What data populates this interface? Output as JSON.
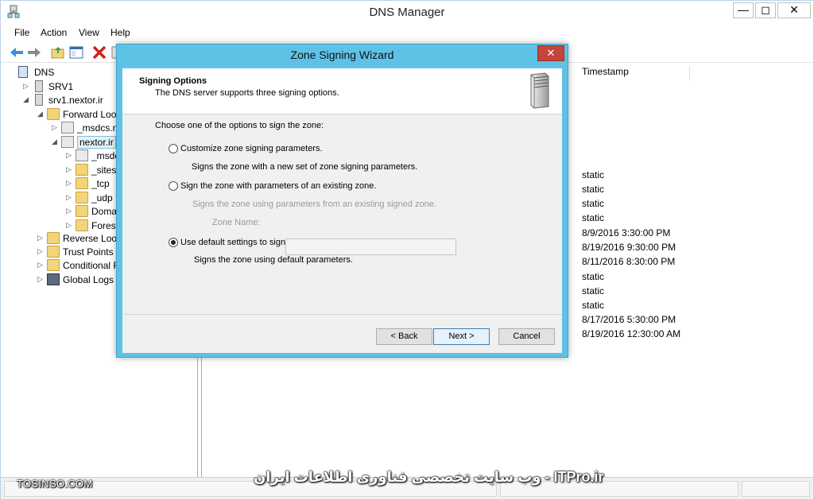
{
  "app": {
    "title": "DNS Manager"
  },
  "window_controls": {
    "minimize": "—",
    "maximize": "◻",
    "close": "✕"
  },
  "menu": [
    "File",
    "Action",
    "View",
    "Help"
  ],
  "tree": [
    {
      "label": "DNS",
      "arrow": ""
    },
    {
      "label": "SRV1",
      "arrow": "▷"
    },
    {
      "label": "srv1.nextor.ir",
      "arrow": "◢"
    },
    {
      "label": "Forward Looku",
      "arrow": "◢"
    },
    {
      "label": "_msdcs.nex",
      "arrow": "▷"
    },
    {
      "label": "nextor.ir",
      "arrow": "◢"
    },
    {
      "label": "_msdcs",
      "arrow": "▷"
    },
    {
      "label": "_sites",
      "arrow": "▷"
    },
    {
      "label": "_tcp",
      "arrow": "▷"
    },
    {
      "label": "_udp",
      "arrow": "▷"
    },
    {
      "label": "Domain",
      "arrow": "▷"
    },
    {
      "label": "ForestDu",
      "arrow": "▷"
    },
    {
      "label": "Reverse Lookup",
      "arrow": "▷"
    },
    {
      "label": "Trust Points",
      "arrow": "▷"
    },
    {
      "label": "Conditional For",
      "arrow": "▷"
    },
    {
      "label": "Global Logs",
      "arrow": "▷"
    }
  ],
  "list": {
    "column_timestamp": "Timestamp",
    "timestamps": [
      "static",
      "static",
      "static",
      "static",
      "8/9/2016 3:30:00 PM",
      "8/19/2016 9:30:00 PM",
      "8/11/2016 8:30:00 PM",
      "static",
      "static",
      "static",
      "8/17/2016 5:30:00 PM",
      "8/19/2016 12:30:00 AM"
    ]
  },
  "dialog": {
    "title": "Zone Signing Wizard",
    "close_label": "✕",
    "header_title": "Signing Options",
    "header_subtitle": "The DNS server supports three signing options.",
    "prompt": "Choose one of the options to sign the zone:",
    "option1_label": "Customize zone signing parameters.",
    "option1_desc": "Signs the zone with a new set of zone signing parameters.",
    "option2_label": "Sign the zone with parameters of an existing zone.",
    "option2_desc": "Signs the zone using parameters from an existing signed zone.",
    "zone_name_label": "Zone Name:",
    "zone_name_value": "",
    "option3_label": "Use default settings to sign the zone.",
    "option3_desc": "Signs the zone using default parameters.",
    "selected_option": 3,
    "back_label": "< Back",
    "next_label": "Next >",
    "cancel_label": "Cancel"
  },
  "watermarks": {
    "left": "TOSINSO.COM",
    "right": "وب سایت تخصصی فناوری اطلاعات ایران - ITPro.ir"
  },
  "colors": {
    "dialog_frame": "#5ec2e6",
    "close_button": "#c7443a",
    "folder": "#f3d47a"
  }
}
